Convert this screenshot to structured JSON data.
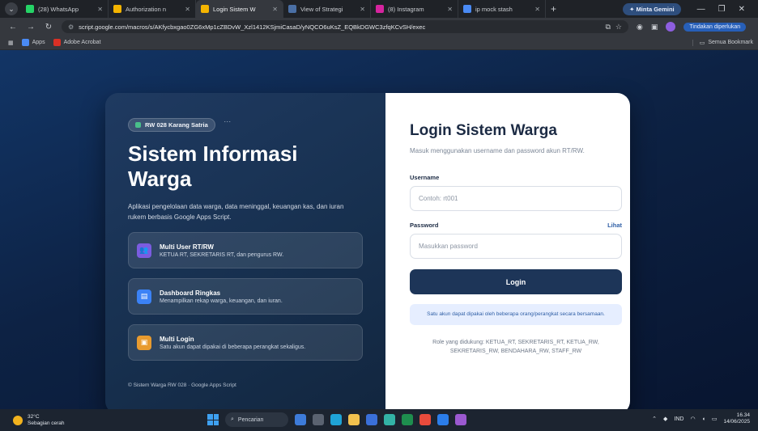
{
  "browser": {
    "tabs": [
      {
        "label": "(28) WhatsApp",
        "color": "#25d366",
        "active": false
      },
      {
        "label": "Authorization n",
        "color": "#f4b400",
        "active": false
      },
      {
        "label": "Login Sistem W",
        "color": "#f4b400",
        "active": true
      },
      {
        "label": "View of Strategi",
        "color": "#4a6fa5",
        "active": false
      },
      {
        "label": "(8) Instagram",
        "color": "#d6249f",
        "active": false
      },
      {
        "label": "ip mock stash",
        "color": "#4a8af4",
        "active": false
      }
    ],
    "gemini_label": "Minta Gemini",
    "url": "script.google.com/macros/s/AKfycbxgao0ZG6xMp1cZBDvW_Xzl1412KSjmiCasaD/yNQCO6uKsZ_EQBkDGWC3zfqKCvSH/exec",
    "cta_label": "Tindakan diperlukan",
    "bookmarks": [
      {
        "label": "Apps",
        "color": "#4a8af4"
      },
      {
        "label": "Adobe Acrobat",
        "color": "#d93025"
      }
    ],
    "bookmarks_right": "Semua Bookmark"
  },
  "left": {
    "badge": "RW 028 Karang Satria",
    "title": "Sistem Informasi Warga",
    "description": "Aplikasi pengelolaan data warga, data meninggal, keuangan kas, dan iuran rukem berbasis Google Apps Script.",
    "features": [
      {
        "title": "Multi User RT/RW",
        "desc": "KETUA RT, SEKRETARIS RT, dan pengurus RW.",
        "icon_color": "#7b5ce0",
        "icon": "user-group-icon"
      },
      {
        "title": "Dashboard Ringkas",
        "desc": "Menampilkan rekap warga, keuangan, dan iuran.",
        "icon_color": "#3b82f6",
        "icon": "dashboard-icon"
      },
      {
        "title": "Multi Login",
        "desc": "Satu akun dapat dipakai di beberapa perangkat sekaligus.",
        "icon_color": "#e89b2f",
        "icon": "devices-icon"
      }
    ],
    "footer": "© Sistem Warga RW 028 · Google Apps Script"
  },
  "login": {
    "title": "Login Sistem Warga",
    "subtitle": "Masuk menggunakan username dan password akun RT/RW.",
    "username_label": "Username",
    "username_placeholder": "Contoh: rt001",
    "password_label": "Password",
    "show_label": "Lihat",
    "password_placeholder": "Masukkan password",
    "button": "Login",
    "info": "Satu akun dapat dipakai oleh beberapa orang/perangkat secara bersamaan.",
    "roles": "Role yang didukung: KETUA_RT, SEKRETARIS_RT, KETUA_RW, SEKRETARIS_RW, BENDAHARA_RW, STAFF_RW"
  },
  "taskbar": {
    "temp": "32°C",
    "weather": "Sebagian cerah",
    "search": "Pencarian",
    "lang": "IND",
    "time": "16.34",
    "date": "14/06/2025"
  },
  "colors": {
    "accent": "#1d3558",
    "link": "#2f5fa6",
    "info_bg": "#e6eeff"
  }
}
